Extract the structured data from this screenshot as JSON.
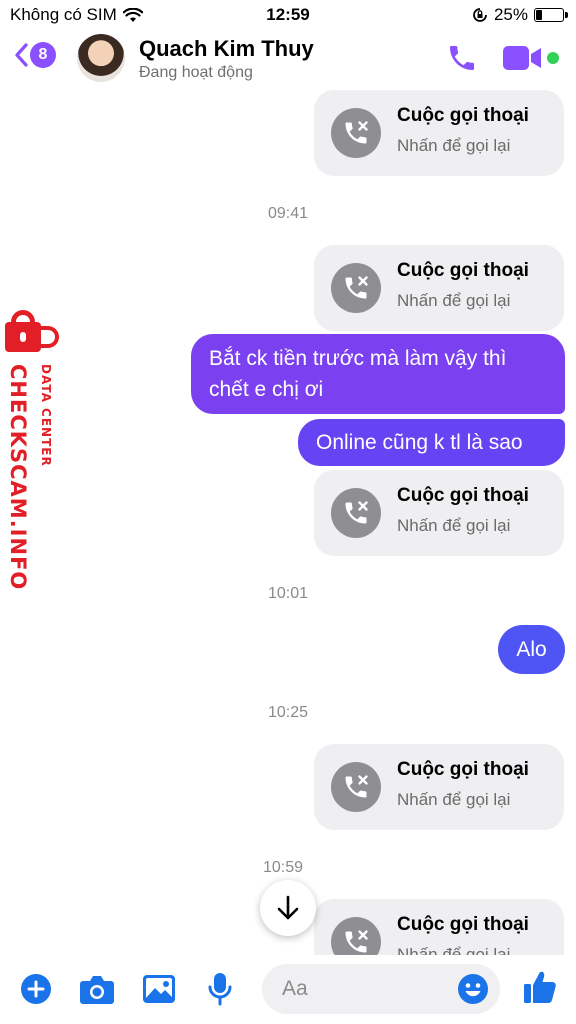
{
  "status_bar": {
    "carrier": "Không có SIM",
    "time": "12:59",
    "battery_percent": "25%",
    "battery_level": 0.25
  },
  "header": {
    "back_badge": "8",
    "contact_name": "Quach Kim Thuy",
    "contact_status": "Đang hoạt động",
    "accent_color": "#8a4fff",
    "online_color": "#31d158"
  },
  "watermark": {
    "brand": "CHECKSCAM.INFO",
    "tagline": "DATA CENTER"
  },
  "messages": {
    "call_title": "Cuộc gọi thoại",
    "call_subtitle": "Nhấn để gọi lại",
    "ts1": "09:41",
    "ts2": "10:01",
    "ts3": "10:25",
    "ts4": "10:59",
    "text1": "Bắt ck tiền trước mà làm vậy thì chết e chị ơi",
    "text1_line1": "Bắt ck tiền trước mà làm vậy thì",
    "text1_line2": "chết e chị ơi",
    "text2": "Online cũng k tl là sao",
    "text3": "Alo"
  },
  "composer": {
    "placeholder": "Aa"
  }
}
